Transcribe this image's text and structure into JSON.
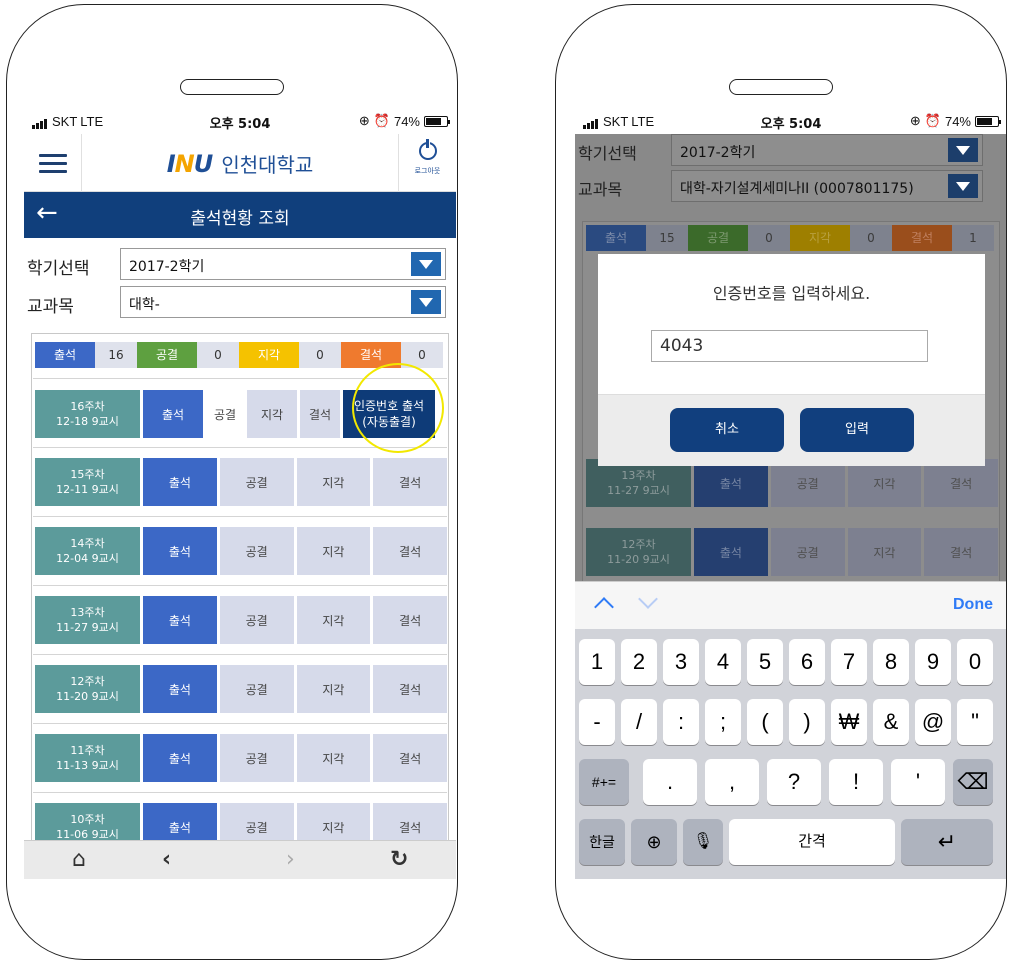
{
  "status_bar": {
    "carrier": "SKT",
    "network": "LTE",
    "time": "오후 5:04",
    "battery": "74%"
  },
  "left": {
    "header": {
      "logo": "INU",
      "brand": "인천대학교",
      "logout_label": "로그아웃"
    },
    "title": "출석현황 조회",
    "semester_label": "학기선택",
    "semester_value": "2017-2학기",
    "course_label": "교과목",
    "course_value": "대학-",
    "summary": [
      {
        "label": "출석",
        "value": "16",
        "color": "#3c68c6"
      },
      {
        "label": "공결",
        "value": "0",
        "color": "#5ea040"
      },
      {
        "label": "지각",
        "value": "0",
        "color": "#f5c200"
      },
      {
        "label": "결석",
        "value": "0",
        "color": "#ef7a2e"
      }
    ],
    "first_week": {
      "week": "16주차",
      "date": "12-18 9교시",
      "attend": "출석",
      "excused": "공결",
      "late": "지각",
      "absent": "결석",
      "cert_line1": "인증번호 출석",
      "cert_line2": "(자동출결)"
    },
    "weeks": [
      {
        "week": "15주차",
        "date": "12-11 9교시"
      },
      {
        "week": "14주차",
        "date": "12-04 9교시"
      },
      {
        "week": "13주차",
        "date": "11-27 9교시"
      },
      {
        "week": "12주차",
        "date": "11-20 9교시"
      },
      {
        "week": "11주차",
        "date": "11-13 9교시"
      },
      {
        "week": "10주차",
        "date": "11-06 9교시"
      }
    ],
    "buttons": {
      "attend": "출석",
      "excused": "공결",
      "late": "지각",
      "absent": "결석"
    }
  },
  "right": {
    "semester_label": "학기선택",
    "semester_value": "2017-2학기",
    "course_label": "교과목",
    "course_value": "대학-자기설계세미나II (0007801175)",
    "summary": [
      {
        "label": "출석",
        "value": "15"
      },
      {
        "label": "공결",
        "value": "0"
      },
      {
        "label": "지각",
        "value": "0"
      },
      {
        "label": "결석",
        "value": "1"
      }
    ],
    "weeks": [
      {
        "week": "13주차",
        "date": "11-27 9교시"
      },
      {
        "week": "12주차",
        "date": "11-20 9교시"
      }
    ],
    "dialog": {
      "message": "인증번호를 입력하세요.",
      "input_value": "4043",
      "cancel": "취소",
      "submit": "입력"
    },
    "keyboard": {
      "done": "Done",
      "row1": [
        "1",
        "2",
        "3",
        "4",
        "5",
        "6",
        "7",
        "8",
        "9",
        "0"
      ],
      "row2": [
        "-",
        "/",
        ":",
        ";",
        "(",
        ")",
        "₩",
        "&",
        "@",
        "\""
      ],
      "row3": [
        ".",
        ",",
        "?",
        "!",
        "'"
      ],
      "symbols_key": "#+=",
      "lang_key": "한글",
      "space": "간격"
    }
  }
}
